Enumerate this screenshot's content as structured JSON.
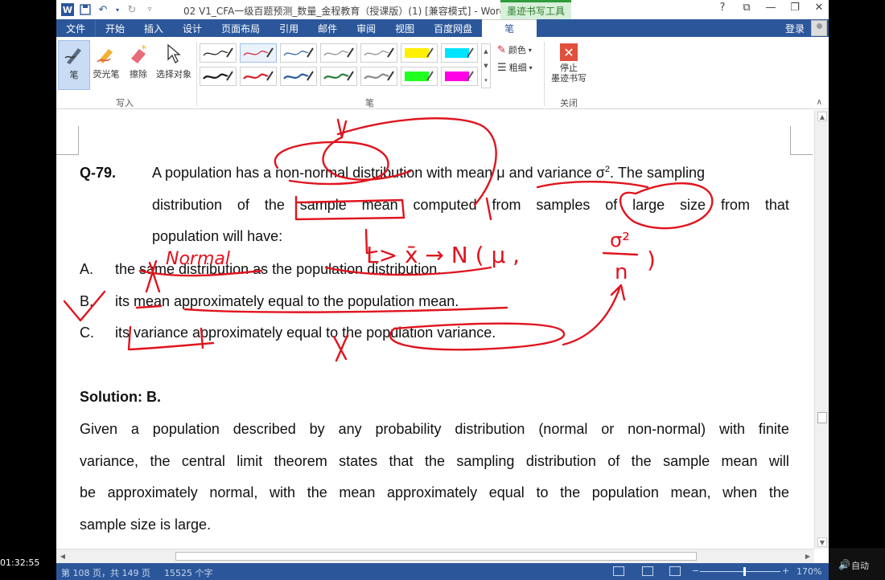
{
  "player": {
    "time": "01:32:55",
    "auto_label": "自动"
  },
  "titlebar": {
    "title": "02 V1_CFA一级百题预测_数量_金程教育（授课版）(1) [兼容模式] - Word",
    "context_tab": "墨迹书写工具",
    "help": "?",
    "restore": "⧉",
    "minimize": "—",
    "maximize": "❐",
    "close": "✕"
  },
  "tabs": {
    "file": "文件",
    "items": [
      "开始",
      "插入",
      "设计",
      "页面布局",
      "引用",
      "邮件",
      "审阅",
      "视图",
      "百度网盘"
    ],
    "active": "笔",
    "login": "登录"
  },
  "ribbon": {
    "tools": [
      "笔",
      "荧光笔",
      "擦除",
      "选择对象"
    ],
    "write_group": "写入",
    "pen_group": "笔",
    "color_label": "颜色",
    "thickness_label": "粗细",
    "stop_label_1": "停止",
    "stop_label_2": "墨迹书写",
    "close_group": "关闭",
    "colors": {
      "black": "#1a1a1a",
      "red": "#d0232b",
      "blue": "#2c5d9e",
      "green": "#2a7d3c",
      "gray": "#8a8a8a",
      "yellow": "#ffef00",
      "cyan": "#00e5ff",
      "lime": "#21ff21",
      "magenta": "#ff00e6"
    }
  },
  "document": {
    "q_number": "Q-79.",
    "q_line1_pre": "A population has a non-normal distribution with mean μ and variance σ",
    "q_line1_sup": "2",
    "q_line1_post": ". The sampling",
    "q_line2": [
      "distribution",
      "of",
      "the",
      "sample",
      "mean",
      "computed",
      "from",
      "samples",
      "of",
      "large",
      "size",
      "from",
      "that"
    ],
    "q_line3": "population will have:",
    "options": [
      {
        "letter": "A.",
        "text": "the same distribution as the population distribution."
      },
      {
        "letter": "B.",
        "text": "its mean approximately equal to the population mean."
      },
      {
        "letter": "C.",
        "text": "its variance approximately equal to the population variance."
      }
    ],
    "solution": "Solution: B.",
    "explanation": [
      [
        "Given",
        "a",
        "population",
        "described",
        "by",
        "any",
        "probability",
        "distribution",
        "(normal",
        "or",
        "non-normal)",
        "with",
        "finite"
      ],
      [
        "variance,",
        "the",
        "central",
        "limit",
        "theorem",
        "states",
        "that",
        "the",
        "sampling",
        "distribution",
        "of",
        "the",
        "sample",
        "mean",
        "will"
      ],
      [
        "be",
        "approximately",
        "normal,",
        "with",
        "the",
        "mean",
        "approximately",
        "equal",
        "to",
        "the",
        "population",
        "mean,",
        "when",
        "the"
      ]
    ],
    "explanation_last": "sample size is large.",
    "ink_text": {
      "normal": "Normal",
      "arrow_formula": "L> x̄ → N ( μ ,",
      "sigma2": "σ²",
      "n": "n",
      "close_paren": ")"
    }
  },
  "status": {
    "page": "第 108 页，共 149 页",
    "words": "15525 个字",
    "zoom": "170%"
  }
}
